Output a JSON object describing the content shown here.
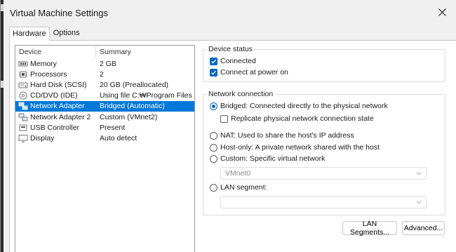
{
  "window": {
    "title": "Virtual Machine Settings"
  },
  "tabs": [
    {
      "label": "Hardware"
    },
    {
      "label": "Options"
    }
  ],
  "device_list": {
    "headers": {
      "device": "Device",
      "summary": "Summary"
    },
    "rows": [
      {
        "icon": "memory-icon",
        "device": "Memory",
        "summary": "2 GB"
      },
      {
        "icon": "processor-icon",
        "device": "Processors",
        "summary": "2"
      },
      {
        "icon": "hard-disk-icon",
        "device": "Hard Disk (SCSI)",
        "summary": "20 GB (Preallocated)"
      },
      {
        "icon": "cd-dvd-icon",
        "device": "CD/DVD (IDE)",
        "summary": "Using file C:₩Program Files ..."
      },
      {
        "icon": "network-adapter-icon",
        "device": "Network Adapter",
        "summary": "Bridged (Automatic)",
        "selected": true
      },
      {
        "icon": "network-adapter-icon",
        "device": "Network Adapter 2",
        "summary": "Custom (VMnet2)"
      },
      {
        "icon": "usb-icon",
        "device": "USB Controller",
        "summary": "Present"
      },
      {
        "icon": "display-icon",
        "device": "Display",
        "summary": "Auto detect"
      }
    ]
  },
  "device_status": {
    "title": "Device status",
    "connected": {
      "label": "Connected",
      "checked": true
    },
    "connect_at_power_on": {
      "label": "Connect at power on",
      "checked": true
    }
  },
  "network_connection": {
    "title": "Network connection",
    "bridged": {
      "label": "Bridged: Connected directly to the physical network",
      "selected": true
    },
    "replicate": {
      "label": "Replicate physical network connection state",
      "checked": false
    },
    "nat": {
      "label": "NAT: Used to share the host's IP address"
    },
    "host_only": {
      "label": "Host-only: A private network shared with the host"
    },
    "custom": {
      "label": "Custom: Specific virtual network"
    },
    "custom_select_value": "VMnet0",
    "lan_segment": {
      "label": "LAN segment:"
    },
    "lan_select_value": ""
  },
  "buttons": {
    "lan_segments": "LAN Segments...",
    "advanced": "Advanced..."
  },
  "colors": {
    "accent": "#0078d7",
    "checkbox": "#0067c0",
    "dialog_bg": "#f0f0f0"
  }
}
